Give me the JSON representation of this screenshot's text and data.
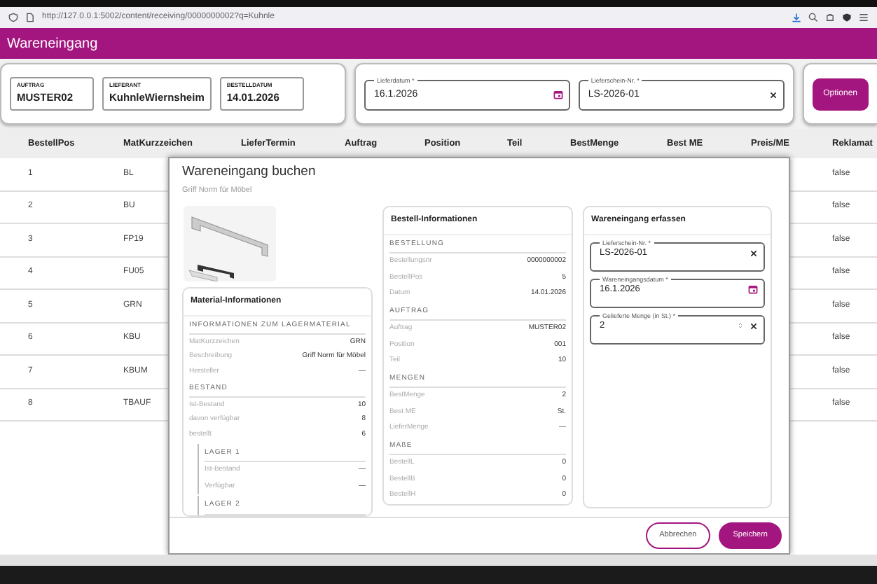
{
  "browser": {
    "url": "http://127.0.0.1:5002/content/receiving/0000000002?q=Kuhnle"
  },
  "header": {
    "title": "Wareneingang"
  },
  "order_info": [
    {
      "label": "AUFTRAG",
      "value": "MUSTER02"
    },
    {
      "label": "LIEFERANT",
      "value": "KuhnleWiernsheim"
    },
    {
      "label": "BESTELLDATUM",
      "value": "14.01.2026"
    }
  ],
  "delivery_fields": [
    {
      "label": "Lieferdatum *",
      "value": "16.1.2026",
      "kind": "date"
    },
    {
      "label": "Lieferschein-Nr. *",
      "value": "LS-2026-01",
      "kind": "clear"
    }
  ],
  "options_button": {
    "label": "Optionen"
  },
  "table": {
    "columns": [
      "BestellPos",
      "MatKurzzeichen",
      "LieferTermin",
      "Auftrag",
      "Position",
      "Teil",
      "BestMenge",
      "Best ME",
      "Preis/ME",
      "Reklamat"
    ],
    "rows": [
      {
        "bestellpos": "1",
        "matkurzzeichen": "BL",
        "reklamation": "false"
      },
      {
        "bestellpos": "2",
        "matkurzzeichen": "BU",
        "reklamation": "false"
      },
      {
        "bestellpos": "3",
        "matkurzzeichen": "FP19",
        "reklamation": "false"
      },
      {
        "bestellpos": "4",
        "matkurzzeichen": "FU05",
        "reklamation": "false"
      },
      {
        "bestellpos": "5",
        "matkurzzeichen": "GRN",
        "reklamation": "false"
      },
      {
        "bestellpos": "6",
        "matkurzzeichen": "KBU",
        "reklamation": "false"
      },
      {
        "bestellpos": "7",
        "matkurzzeichen": "KBUM",
        "reklamation": "false"
      },
      {
        "bestellpos": "8",
        "matkurzzeichen": "TBAUF",
        "reklamation": "false"
      }
    ]
  },
  "dialog": {
    "title": "Wareneingang buchen",
    "subtitle": "Griff Norm für Möbel",
    "material_card": {
      "title": "Material-Informationen",
      "sections": [
        {
          "title": "INFORMATIONEN ZUM LAGERMATERIAL",
          "rows": [
            {
              "label": "MatKurzzeichen",
              "value": "GRN"
            },
            {
              "label": "Beschreibung",
              "value": "Griff Norm für Möbel"
            },
            {
              "label": "Hersteller",
              "value": "—"
            }
          ]
        },
        {
          "title": "BESTAND",
          "rows": [
            {
              "label": "Ist-Bestand",
              "value": "10"
            },
            {
              "label": "davon verfügbar",
              "value": "8"
            },
            {
              "label": "bestellt",
              "value": "6"
            }
          ],
          "groups": [
            {
              "title": "LAGER 1",
              "rows": [
                {
                  "label": "Ist-Bestand",
                  "value": "—"
                },
                {
                  "label": "Verfügbar",
                  "value": "—"
                }
              ]
            },
            {
              "title": "LAGER 2"
            }
          ]
        }
      ]
    },
    "order_card": {
      "title": "Bestell-Informationen",
      "sections": [
        {
          "title": "BESTELLUNG",
          "rows": [
            {
              "label": "Bestellungsnr",
              "value": "0000000002"
            },
            {
              "label": "BestellPos",
              "value": "5"
            },
            {
              "label": "Datum",
              "value": "14.01.2026"
            }
          ]
        },
        {
          "title": "AUFTRAG",
          "rows": [
            {
              "label": "Auftrag",
              "value": "MUSTER02"
            },
            {
              "label": "Position",
              "value": "001"
            },
            {
              "label": "Teil",
              "value": "10"
            }
          ]
        },
        {
          "title": "MENGEN",
          "rows": [
            {
              "label": "BestMenge",
              "value": "2"
            },
            {
              "label": "Best ME",
              "value": "St."
            },
            {
              "label": "LieferMenge",
              "value": "—"
            }
          ]
        },
        {
          "title": "MAßE",
          "rows": [
            {
              "label": "BestellL",
              "value": "0"
            },
            {
              "label": "BestellB",
              "value": "0"
            },
            {
              "label": "BestellH",
              "value": "0"
            }
          ]
        }
      ]
    },
    "entry_card": {
      "title": "Wareneingang erfassen",
      "fields": [
        {
          "label": "Lieferschein-Nr. *",
          "value": "LS-2026-01",
          "kind": "clear"
        },
        {
          "label": "Wareneingangsdatum *",
          "value": "16.1.2026",
          "kind": "date"
        },
        {
          "label": "Gelieferte Menge (in St.) *",
          "value": "2",
          "kind": "number"
        }
      ]
    },
    "buttons": [
      {
        "label": "Abbrechen",
        "kind": "secondary"
      },
      {
        "label": "Speichern",
        "kind": "primary"
      }
    ]
  }
}
